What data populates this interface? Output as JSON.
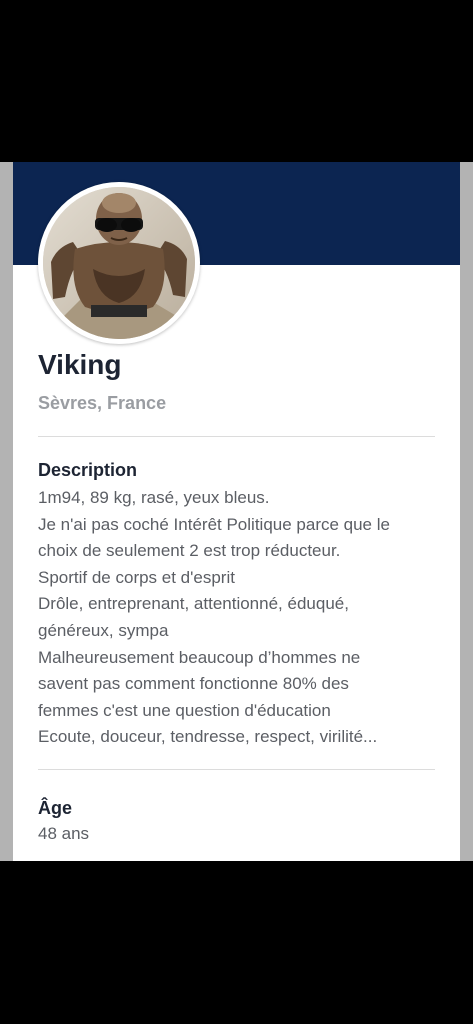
{
  "profile": {
    "name": "Viking",
    "location": "Sèvres, France"
  },
  "description": {
    "title": "Description",
    "lines": [
      "1m94, 89 kg, rasé, yeux bleus.",
      "Je n'ai pas coché Intérêt Politique parce que le",
      "choix de seulement 2 est trop réducteur.",
      "Sportif de corps et d'esprit",
      "Drôle, entreprenant, attentionné, éduqué,",
      "généreux, sympa",
      "Malheureusement beaucoup d’hommes ne",
      "savent pas comment fonctionne 80% des",
      "femmes c'est une question d'éducation",
      "Ecoute, douceur, tendresse, respect, virilité..."
    ]
  },
  "age": {
    "title": "Âge",
    "value": "48 ans"
  },
  "colors": {
    "header": "#0c2551",
    "name": "#1d2433",
    "location": "#9a9da2",
    "body_text": "#5b5e64"
  },
  "icons": {
    "avatar": "profile-photo"
  }
}
